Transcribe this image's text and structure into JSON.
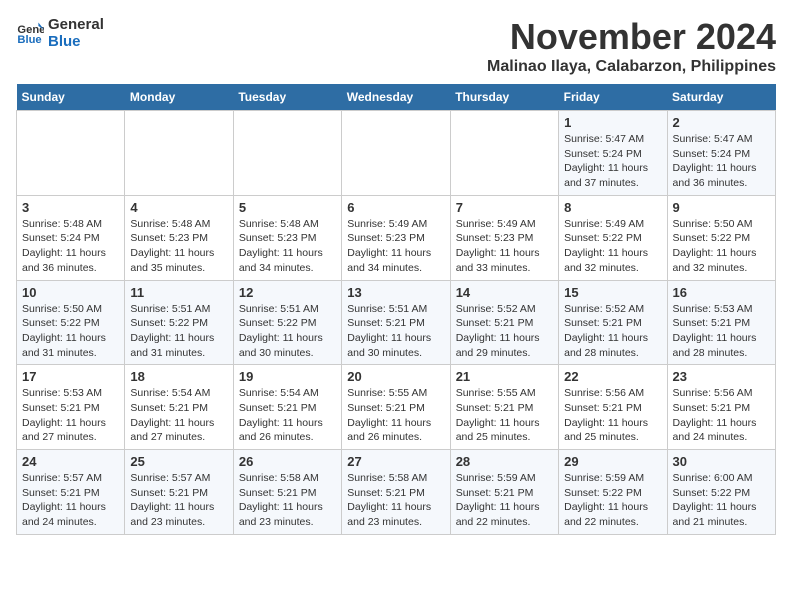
{
  "logo": {
    "line1": "General",
    "line2": "Blue"
  },
  "title": "November 2024",
  "subtitle": "Malinao Ilaya, Calabarzon, Philippines",
  "days_of_week": [
    "Sunday",
    "Monday",
    "Tuesday",
    "Wednesday",
    "Thursday",
    "Friday",
    "Saturday"
  ],
  "weeks": [
    [
      {
        "day": "",
        "info": ""
      },
      {
        "day": "",
        "info": ""
      },
      {
        "day": "",
        "info": ""
      },
      {
        "day": "",
        "info": ""
      },
      {
        "day": "",
        "info": ""
      },
      {
        "day": "1",
        "info": "Sunrise: 5:47 AM\nSunset: 5:24 PM\nDaylight: 11 hours and 37 minutes."
      },
      {
        "day": "2",
        "info": "Sunrise: 5:47 AM\nSunset: 5:24 PM\nDaylight: 11 hours and 36 minutes."
      }
    ],
    [
      {
        "day": "3",
        "info": "Sunrise: 5:48 AM\nSunset: 5:24 PM\nDaylight: 11 hours and 36 minutes."
      },
      {
        "day": "4",
        "info": "Sunrise: 5:48 AM\nSunset: 5:23 PM\nDaylight: 11 hours and 35 minutes."
      },
      {
        "day": "5",
        "info": "Sunrise: 5:48 AM\nSunset: 5:23 PM\nDaylight: 11 hours and 34 minutes."
      },
      {
        "day": "6",
        "info": "Sunrise: 5:49 AM\nSunset: 5:23 PM\nDaylight: 11 hours and 34 minutes."
      },
      {
        "day": "7",
        "info": "Sunrise: 5:49 AM\nSunset: 5:23 PM\nDaylight: 11 hours and 33 minutes."
      },
      {
        "day": "8",
        "info": "Sunrise: 5:49 AM\nSunset: 5:22 PM\nDaylight: 11 hours and 32 minutes."
      },
      {
        "day": "9",
        "info": "Sunrise: 5:50 AM\nSunset: 5:22 PM\nDaylight: 11 hours and 32 minutes."
      }
    ],
    [
      {
        "day": "10",
        "info": "Sunrise: 5:50 AM\nSunset: 5:22 PM\nDaylight: 11 hours and 31 minutes."
      },
      {
        "day": "11",
        "info": "Sunrise: 5:51 AM\nSunset: 5:22 PM\nDaylight: 11 hours and 31 minutes."
      },
      {
        "day": "12",
        "info": "Sunrise: 5:51 AM\nSunset: 5:22 PM\nDaylight: 11 hours and 30 minutes."
      },
      {
        "day": "13",
        "info": "Sunrise: 5:51 AM\nSunset: 5:21 PM\nDaylight: 11 hours and 30 minutes."
      },
      {
        "day": "14",
        "info": "Sunrise: 5:52 AM\nSunset: 5:21 PM\nDaylight: 11 hours and 29 minutes."
      },
      {
        "day": "15",
        "info": "Sunrise: 5:52 AM\nSunset: 5:21 PM\nDaylight: 11 hours and 28 minutes."
      },
      {
        "day": "16",
        "info": "Sunrise: 5:53 AM\nSunset: 5:21 PM\nDaylight: 11 hours and 28 minutes."
      }
    ],
    [
      {
        "day": "17",
        "info": "Sunrise: 5:53 AM\nSunset: 5:21 PM\nDaylight: 11 hours and 27 minutes."
      },
      {
        "day": "18",
        "info": "Sunrise: 5:54 AM\nSunset: 5:21 PM\nDaylight: 11 hours and 27 minutes."
      },
      {
        "day": "19",
        "info": "Sunrise: 5:54 AM\nSunset: 5:21 PM\nDaylight: 11 hours and 26 minutes."
      },
      {
        "day": "20",
        "info": "Sunrise: 5:55 AM\nSunset: 5:21 PM\nDaylight: 11 hours and 26 minutes."
      },
      {
        "day": "21",
        "info": "Sunrise: 5:55 AM\nSunset: 5:21 PM\nDaylight: 11 hours and 25 minutes."
      },
      {
        "day": "22",
        "info": "Sunrise: 5:56 AM\nSunset: 5:21 PM\nDaylight: 11 hours and 25 minutes."
      },
      {
        "day": "23",
        "info": "Sunrise: 5:56 AM\nSunset: 5:21 PM\nDaylight: 11 hours and 24 minutes."
      }
    ],
    [
      {
        "day": "24",
        "info": "Sunrise: 5:57 AM\nSunset: 5:21 PM\nDaylight: 11 hours and 24 minutes."
      },
      {
        "day": "25",
        "info": "Sunrise: 5:57 AM\nSunset: 5:21 PM\nDaylight: 11 hours and 23 minutes."
      },
      {
        "day": "26",
        "info": "Sunrise: 5:58 AM\nSunset: 5:21 PM\nDaylight: 11 hours and 23 minutes."
      },
      {
        "day": "27",
        "info": "Sunrise: 5:58 AM\nSunset: 5:21 PM\nDaylight: 11 hours and 23 minutes."
      },
      {
        "day": "28",
        "info": "Sunrise: 5:59 AM\nSunset: 5:21 PM\nDaylight: 11 hours and 22 minutes."
      },
      {
        "day": "29",
        "info": "Sunrise: 5:59 AM\nSunset: 5:22 PM\nDaylight: 11 hours and 22 minutes."
      },
      {
        "day": "30",
        "info": "Sunrise: 6:00 AM\nSunset: 5:22 PM\nDaylight: 11 hours and 21 minutes."
      }
    ]
  ]
}
